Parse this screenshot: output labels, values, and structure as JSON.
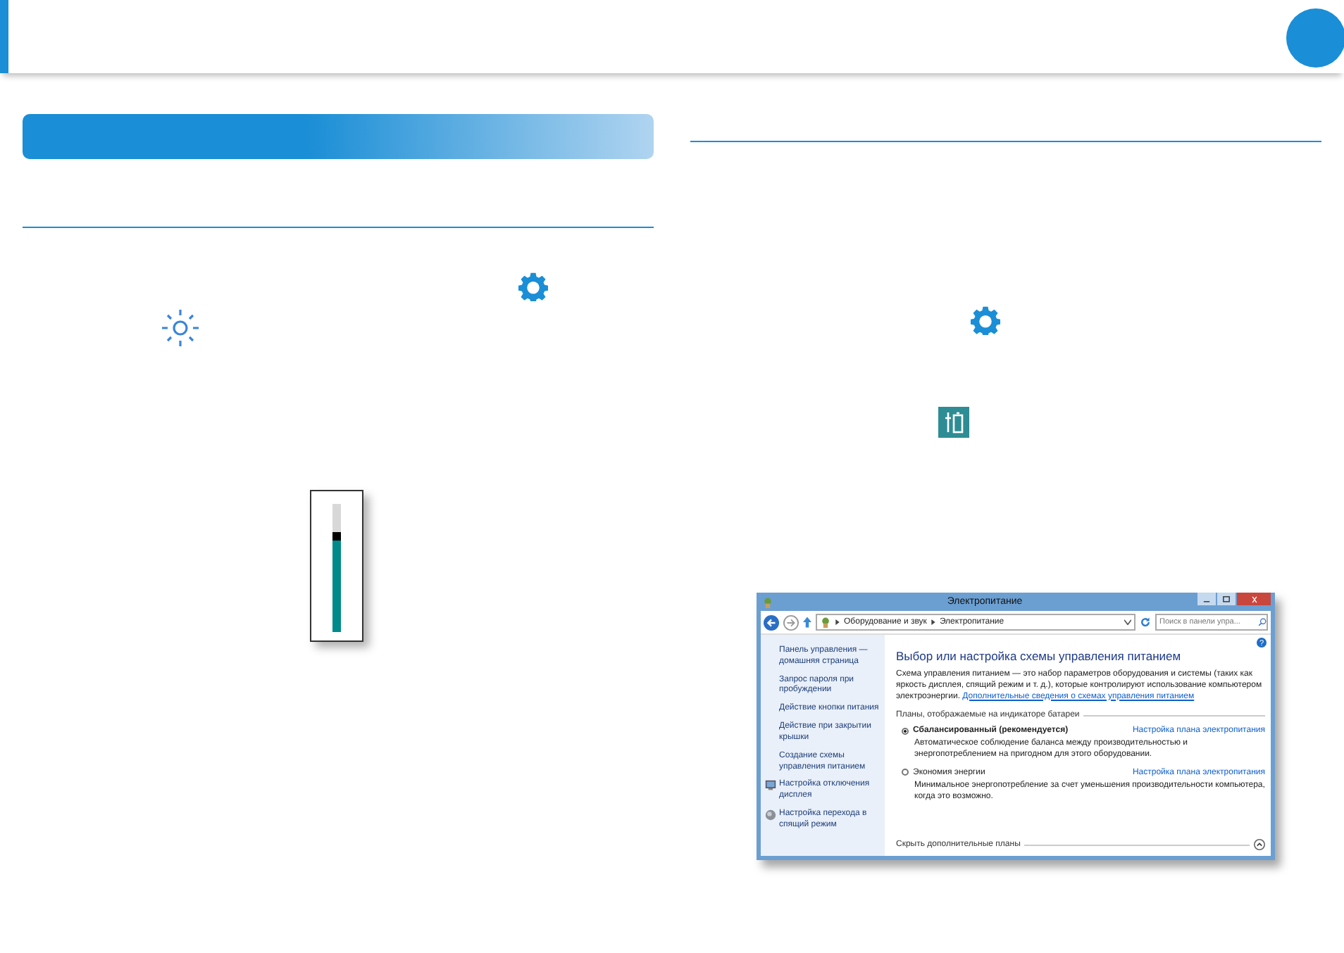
{
  "brightness_slider": {
    "level": 0.78
  },
  "window": {
    "title": "Электропитание",
    "breadcrumb": [
      "Оборудование и звук",
      "Электропитание"
    ],
    "search": {
      "placeholder": "Поиск в панели упра..."
    },
    "sidebar": {
      "items": [
        {
          "label": "Панель управления — домашняя страница",
          "kind": "plain"
        },
        {
          "label": "Запрос пароля при пробуждении",
          "kind": "plain"
        },
        {
          "label": "Действие кнопки питания",
          "kind": "plain"
        },
        {
          "label": "Действие при закрытии крышки",
          "kind": "plain"
        },
        {
          "label": "Создание схемы управления питанием",
          "kind": "plain"
        },
        {
          "label": "Настройка отключения дисплея",
          "kind": "display"
        },
        {
          "label": "Настройка перехода в спящий режим",
          "kind": "sleep"
        }
      ]
    },
    "help": "?",
    "heading": "Выбор или настройка схемы управления питанием",
    "description": "Схема управления питанием — это набор параметров оборудования и системы (таких как яркость дисплея, спящий режим и т. д.), которые контролируют использование компьютером электроэнергии.",
    "description_link": "Дополнительные сведения о схемах управления питанием",
    "plans_label": "Планы, отображаемые на индикаторе батареи",
    "plans": [
      {
        "name": "Сбалансированный (рекомендуется)",
        "selected": true,
        "settings_link": "Настройка плана электропитания",
        "description": "Автоматическое соблюдение баланса между производительностью и энергопотреблением на пригодном для этого оборудовании."
      },
      {
        "name": "Экономия энергии",
        "selected": false,
        "settings_link": "Настройка плана электропитания",
        "description": "Минимальное энергопотребление за счет уменьшения производительности компьютера, когда это возможно."
      }
    ],
    "more_plans": "Скрыть дополнительные планы"
  }
}
